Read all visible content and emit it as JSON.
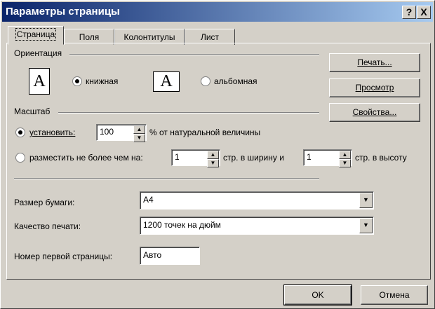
{
  "window": {
    "title": "Параметры страницы"
  },
  "titlebar": {
    "help_label": "?",
    "close_label": "X"
  },
  "tabs": [
    "Страница",
    "Поля",
    "Колонтитулы",
    "Лист"
  ],
  "orientation": {
    "label": "Ориентация",
    "portrait_icon": "A",
    "landscape_icon": "A",
    "portrait_label": "книжная",
    "landscape_label": "альбомная",
    "selected": "portrait"
  },
  "scale": {
    "label": "Масштаб",
    "set_label": "установить:",
    "set_value": "100",
    "set_suffix": "% от натуральной величины",
    "fit_label": "разместить не более чем на:",
    "fit_width_value": "1",
    "fit_width_suffix": "стр. в ширину и",
    "fit_height_value": "1",
    "fit_height_suffix": "стр. в высоту",
    "selected": "set"
  },
  "paper": {
    "label": "Размер бумаги:",
    "value": "A4"
  },
  "quality": {
    "label": "Качество печати:",
    "value": "1200 точек на дюйм"
  },
  "first_page": {
    "label": "Номер первой страницы:",
    "value": "Авто"
  },
  "side_buttons": {
    "print": "Печать...",
    "preview": "Просмотр",
    "properties": "Свойства..."
  },
  "footer": {
    "ok": "OK",
    "cancel": "Отмена"
  }
}
